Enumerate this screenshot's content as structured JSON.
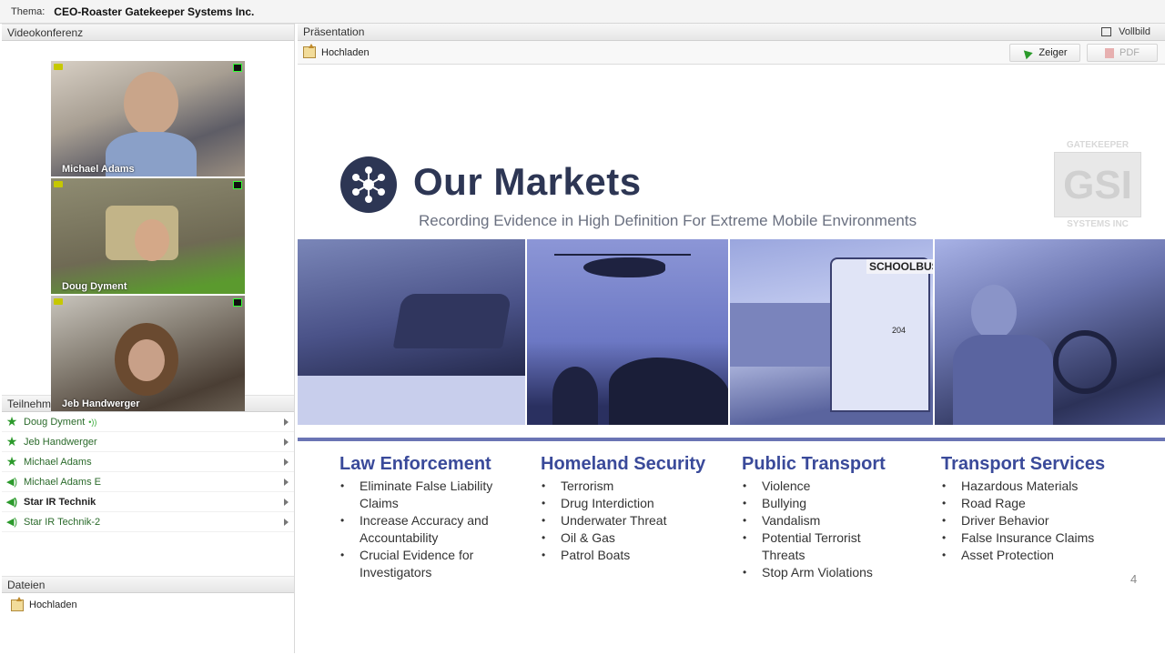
{
  "topbar": {
    "label": "Thema:",
    "title": "CEO-Roaster Gatekeeper Systems Inc."
  },
  "video": {
    "header": "Videokonferenz",
    "feeds": [
      {
        "name": "Michael Adams"
      },
      {
        "name": "Doug Dyment"
      },
      {
        "name": "Jeb Handwerger"
      }
    ]
  },
  "participants": {
    "header": "Teilnehmer",
    "items": [
      {
        "name": "Doug Dyment",
        "icon": "star-icon",
        "extra": "•))"
      },
      {
        "name": "Jeb Handwerger",
        "icon": "star-icon"
      },
      {
        "name": "Michael Adams",
        "icon": "star-icon"
      },
      {
        "name": "Michael Adams E",
        "icon": "speaker-icon"
      },
      {
        "name": "Star IR Technik",
        "icon": "speaker-icon"
      },
      {
        "name": "Star IR Technik-2",
        "icon": "speaker-icon"
      }
    ]
  },
  "files": {
    "header": "Dateien",
    "upload_label": "Hochladen"
  },
  "presentation": {
    "header": "Präsentation",
    "fullscreen_label": "Vollbild",
    "upload_label": "Hochladen",
    "pointer_label": "Zeiger",
    "pdf_label": "PDF"
  },
  "slide": {
    "title": "Our Markets",
    "subtitle": "Recording Evidence in High Definition For Extreme Mobile Environments",
    "logo_top": "GATEKEEPER",
    "logo_mid": "GSI",
    "logo_bottom": "SYSTEMS INC",
    "page_number": "4",
    "columns": [
      {
        "heading": "Law Enforcement",
        "items": [
          "Eliminate False Liability Claims",
          "Increase Accuracy and Accountability",
          "Crucial Evidence for Investigators"
        ]
      },
      {
        "heading": "Homeland Security",
        "items": [
          "Terrorism",
          "Drug Interdiction",
          "Underwater Threat",
          "Oil & Gas",
          "Patrol Boats"
        ]
      },
      {
        "heading": "Public Transport",
        "items": [
          "Violence",
          "Bullying",
          "Vandalism",
          "Potential Terrorist Threats",
          "Stop Arm Violations"
        ]
      },
      {
        "heading": "Transport Services",
        "items": [
          "Hazardous Materials",
          "Road Rage",
          "Driver Behavior",
          "False Insurance Claims",
          "Asset Protection"
        ]
      }
    ],
    "school_bus_text": "SCHOOLBUS",
    "bus_number": "204"
  },
  "colors": {
    "accent": "#2d3654",
    "heading_blue": "#3a4a9a",
    "online_green": "#2c9a2c"
  }
}
